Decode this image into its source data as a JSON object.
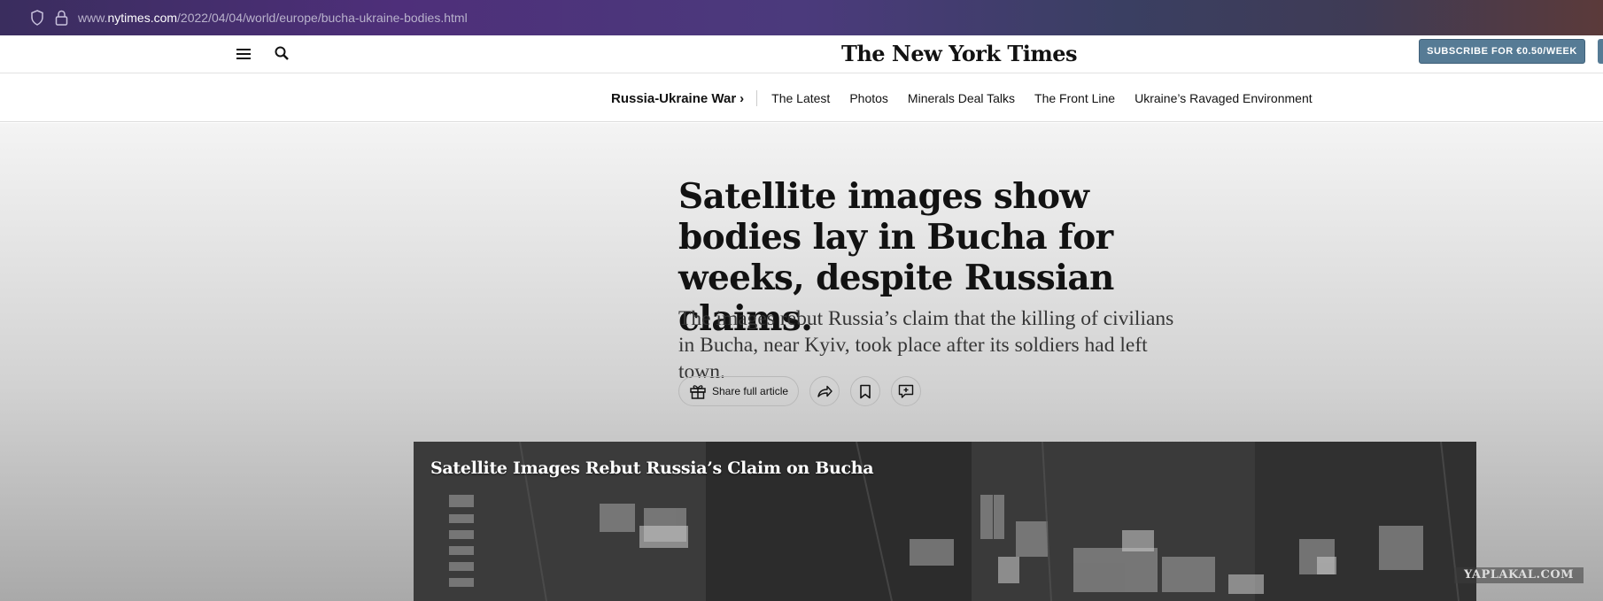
{
  "browser": {
    "url_prefix": "www.",
    "url_domain": "nytimes.com",
    "url_path": "/2022/04/04/world/europe/bucha-ukraine-bodies.html"
  },
  "masthead": {
    "logo_text": "The New York Times",
    "subscribe_label": "SUBSCRIBE FOR €0.50/WEEK"
  },
  "section_nav": {
    "title": "Russia-Ukraine War",
    "title_chevron": "›",
    "links": [
      "The Latest",
      "Photos",
      "Minerals Deal Talks",
      "The Front Line",
      "Ukraine’s Ravaged Environment"
    ]
  },
  "article": {
    "headline": "Satellite images show bodies lay in Bucha for weeks, despite Russian claims.",
    "summary": "The images rebut Russia’s claim that the killing of civilians in Bucha, near Kyiv, took place after its soldiers had left town.",
    "share_label": "Share full article"
  },
  "media": {
    "caption": "Satellite Images Rebut Russia’s Claim on Bucha"
  },
  "watermark": {
    "text": "YAPLAKAL.COM"
  },
  "colors": {
    "subscribe_bg": "#567b95",
    "headline": "#121212",
    "summary": "#363636"
  }
}
